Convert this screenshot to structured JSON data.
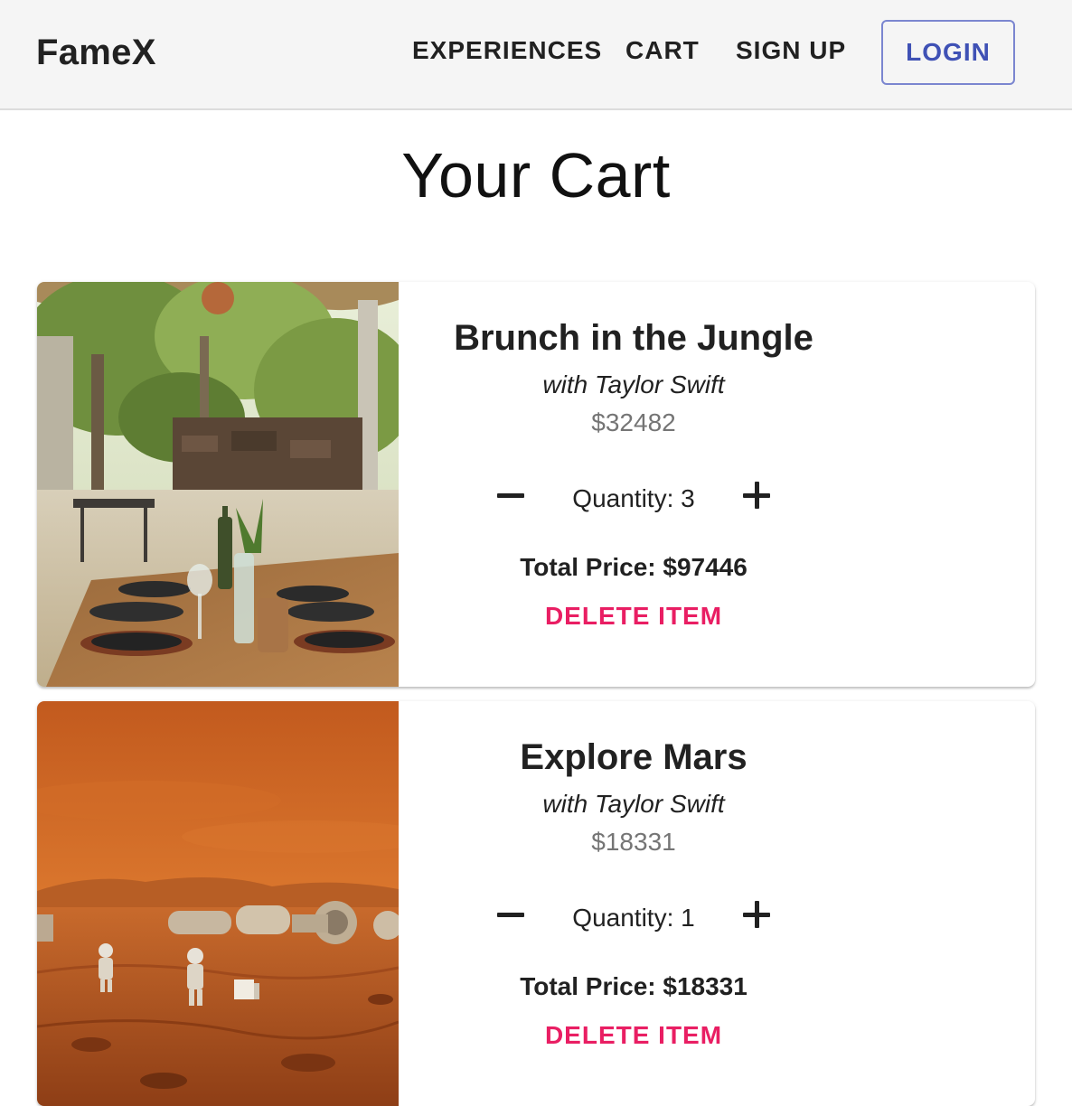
{
  "app": {
    "brand": "FameX"
  },
  "nav": {
    "experiences": "EXPERIENCES",
    "cart": "CART",
    "signup": "SIGN UP",
    "login": "LOGIN"
  },
  "page": {
    "title": "Your Cart"
  },
  "cart_items": [
    {
      "title": "Brunch in the Jungle",
      "host": "with Taylor Swift",
      "price": "$32482",
      "quantity_label": "Quantity: 3",
      "total_price": "Total Price: $97446",
      "delete_label": "DELETE ITEM",
      "image": "jungle-dining-table-photo"
    },
    {
      "title": "Explore Mars",
      "host": "with Taylor Swift",
      "price": "$18331",
      "quantity_label": "Quantity: 1",
      "total_price": "Total Price: $18331",
      "delete_label": "DELETE ITEM",
      "image": "mars-astronaut-base-photo"
    }
  ],
  "colors": {
    "appbar_bg": "#f5f5f5",
    "login_accent": "#3f51b5",
    "delete_accent": "#e91e63",
    "price_gray": "#757575"
  }
}
